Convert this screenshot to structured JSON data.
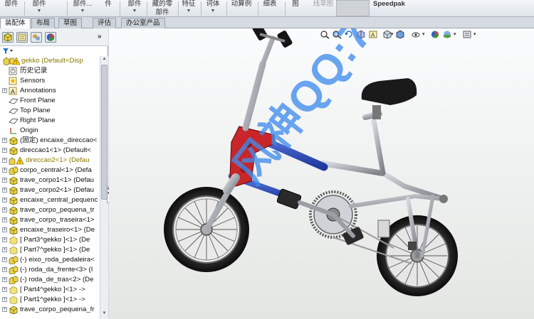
{
  "ribbon": {
    "items": [
      {
        "label": "部件",
        "caret": ""
      },
      {
        "label": "部件",
        "caret": "▼"
      },
      {
        "label": "部件...",
        "caret": "▼"
      },
      {
        "label": "件",
        "caret": ""
      },
      {
        "label": "部件",
        "caret": "▼"
      },
      {
        "label": "藏的零部件",
        "caret": "▼"
      },
      {
        "label": "特征",
        "caret": "▼"
      },
      {
        "label": "诃体",
        "caret": "▼"
      },
      {
        "label": "动算例",
        "caret": ""
      },
      {
        "label": "细表",
        "caret": ""
      },
      {
        "label": "图",
        "caret": ""
      },
      {
        "label": "线草图",
        "caret": ""
      },
      {
        "label": "Speedpak",
        "caret": ""
      }
    ]
  },
  "tabs": [
    "装配体",
    "布局",
    "草图",
    "评估",
    "办公室产品"
  ],
  "panel": {
    "expand_label": "»",
    "filter_icon": "filter-icon",
    "tree": [
      {
        "label": "gekko  (Default<Disp",
        "icon": "assembly-warning-icon",
        "pm": "",
        "indent": 0,
        "style": "yellow"
      },
      {
        "label": "历史记录",
        "icon": "history-icon",
        "pm": "",
        "indent": 1,
        "style": ""
      },
      {
        "label": "Sensors",
        "icon": "sensors-icon",
        "pm": "",
        "indent": 1,
        "style": ""
      },
      {
        "label": "Annotations",
        "icon": "annotations-icon",
        "pm": "+",
        "indent": 1,
        "style": ""
      },
      {
        "label": "Front Plane",
        "icon": "plane-icon",
        "pm": "",
        "indent": 1,
        "style": ""
      },
      {
        "label": "Top Plane",
        "icon": "plane-icon",
        "pm": "",
        "indent": 1,
        "style": ""
      },
      {
        "label": "Right Plane",
        "icon": "plane-icon",
        "pm": "",
        "indent": 1,
        "style": ""
      },
      {
        "label": "Origin",
        "icon": "origin-icon",
        "pm": "",
        "indent": 1,
        "style": ""
      },
      {
        "label": "(固定) encaixe_direccao<",
        "icon": "part-icon",
        "pm": "+",
        "indent": 1,
        "style": ""
      },
      {
        "label": "direccao1<1> (Default<",
        "icon": "part-icon",
        "pm": "+",
        "indent": 1,
        "style": ""
      },
      {
        "label": "direccao2<1> (Defau",
        "icon": "subassembly-warning-icon",
        "pm": "+",
        "indent": 1,
        "style": "yellow"
      },
      {
        "label": "corpo_central<1> (Defa",
        "icon": "subassembly-icon",
        "pm": "+",
        "indent": 1,
        "style": ""
      },
      {
        "label": "trave_corpo1<1> (Defau",
        "icon": "part-icon",
        "pm": "+",
        "indent": 1,
        "style": ""
      },
      {
        "label": "trave_corpo2<1> (Defau",
        "icon": "part-icon",
        "pm": "+",
        "indent": 1,
        "style": ""
      },
      {
        "label": "encaixe_central_pequenc",
        "icon": "part-icon",
        "pm": "+",
        "indent": 1,
        "style": ""
      },
      {
        "label": "trave_corpo_pequena_tr",
        "icon": "part-icon",
        "pm": "+",
        "indent": 1,
        "style": ""
      },
      {
        "label": "trave_corpo_traseira<1>",
        "icon": "part-icon",
        "pm": "+",
        "indent": 1,
        "style": ""
      },
      {
        "label": "encaixe_traseiro<1> (De",
        "icon": "part-icon",
        "pm": "+",
        "indent": 1,
        "style": ""
      },
      {
        "label": "[ Part3^gekko ]<1> (De",
        "icon": "virtual-part-icon",
        "pm": "+",
        "indent": 1,
        "style": ""
      },
      {
        "label": "[ Part7^gekko ]<1> (De",
        "icon": "virtual-part-icon",
        "pm": "+",
        "indent": 1,
        "style": ""
      },
      {
        "label": "(-) eixo_roda_pedaleira<",
        "icon": "subassembly-icon",
        "pm": "+",
        "indent": 1,
        "style": ""
      },
      {
        "label": "(-) roda_da_frente<3> (I",
        "icon": "subassembly-icon",
        "pm": "+",
        "indent": 1,
        "style": ""
      },
      {
        "label": "(-) roda_de_tras<2> (De",
        "icon": "subassembly-icon",
        "pm": "+",
        "indent": 1,
        "style": ""
      },
      {
        "label": "[ Part4^gekko ]<1> ->",
        "icon": "virtual-part-icon",
        "pm": "+",
        "indent": 1,
        "style": ""
      },
      {
        "label": "[ Part1^gekko ]<1> ->",
        "icon": "virtual-part-icon",
        "pm": "+",
        "indent": 1,
        "style": ""
      },
      {
        "label": "trave_corpo_pequena_fr",
        "icon": "part-icon",
        "pm": "+",
        "indent": 1,
        "style": ""
      }
    ]
  },
  "viewport": {
    "watermark": "风神QQ:7615339",
    "toolbar_icons": [
      "zoom-to-fit-icon",
      "zoom-area-icon",
      "previous-view-icon",
      "section-view-icon",
      "dynamic-annotation-icon",
      "view-orientation-icon",
      "display-style-icon",
      "hide-show-icon",
      "edit-appearance-icon",
      "apply-scene-icon",
      "view-settings-icon"
    ]
  },
  "colors": {
    "frame_red": "#c8262a",
    "frame_blue": "#2d4fb8",
    "metal_grey": "#8e9298",
    "tire_black": "#161616",
    "watermark_blue": "#3f8cec"
  }
}
